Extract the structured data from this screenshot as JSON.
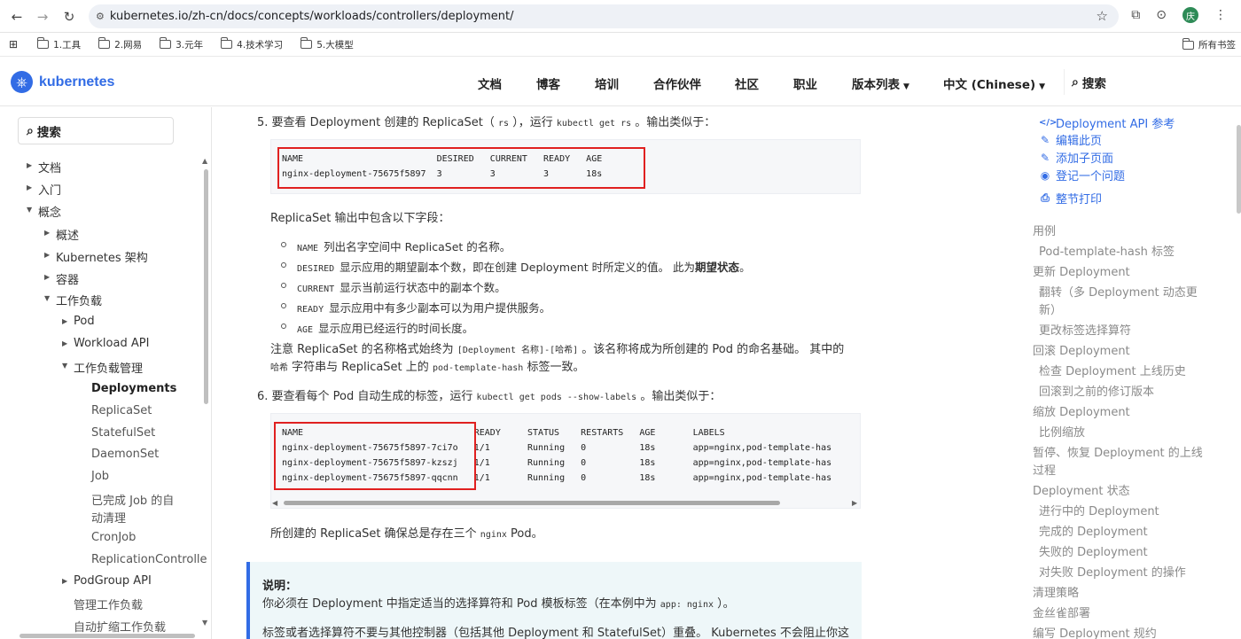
{
  "browser": {
    "url": "kubernetes.io/zh-cn/docs/concepts/workloads/controllers/deployment/",
    "avatar_text": "庆",
    "bookmarks": [
      "1.工具",
      "2.网易",
      "3.元年",
      "4.技术学习",
      "5.大模型"
    ],
    "all_bookmarks": "所有书签"
  },
  "header": {
    "logo": "kubernetes",
    "nav": [
      "文档",
      "博客",
      "培训",
      "合作伙伴",
      "社区",
      "职业",
      "版本列表",
      "中文 (Chinese)"
    ],
    "search": "搜索"
  },
  "sidebar": {
    "search": "搜索",
    "items": [
      {
        "label": "文档",
        "state": "collapsed"
      },
      {
        "label": "入门",
        "state": "collapsed"
      },
      {
        "label": "概念",
        "state": "expanded"
      },
      {
        "label": "概述",
        "state": "collapsed"
      },
      {
        "label": "Kubernetes 架构",
        "state": "collapsed"
      },
      {
        "label": "容器",
        "state": "collapsed"
      },
      {
        "label": "工作负载",
        "state": "expanded"
      },
      {
        "label": "Pod",
        "state": "collapsed"
      },
      {
        "label": "Workload API",
        "state": "collapsed"
      },
      {
        "label": "工作负载管理",
        "state": "expanded"
      },
      {
        "label": "Deployments",
        "state": "active"
      },
      {
        "label": "ReplicaSet",
        "state": "leaf"
      },
      {
        "label": "StatefulSet",
        "state": "leaf"
      },
      {
        "label": "DaemonSet",
        "state": "leaf"
      },
      {
        "label": "Job",
        "state": "leaf"
      },
      {
        "label": "已完成 Job 的自",
        "state": "leaf"
      },
      {
        "label": "动清理",
        "state": "leaf"
      },
      {
        "label": "CronJob",
        "state": "leaf"
      },
      {
        "label": "ReplicationControlle",
        "state": "leaf"
      },
      {
        "label": "PodGroup API",
        "state": "collapsed"
      },
      {
        "label": "管理工作负载",
        "state": "leaf"
      },
      {
        "label": "自动扩缩工作负载",
        "state": "leaf"
      }
    ]
  },
  "content": {
    "step5": {
      "num": "5.",
      "text_a": "要查看 Deployment 创建的 ReplicaSet（",
      "code_a": "rs",
      "text_b": "），运行",
      "code_b": "kubectl get rs",
      "text_c": "。输出类似于："
    },
    "rs_output": {
      "line1": "NAME                         DESIRED   CURRENT   READY   AGE",
      "line2": "nginx-deployment-75675f5897  3         3         3       18s"
    },
    "rs_fields_intro": "ReplicaSet 输出中包含以下字段：",
    "fields": [
      {
        "code": "NAME",
        "text": "列出名字空间中 ReplicaSet 的名称。"
      },
      {
        "code": "DESIRED",
        "text": "显示应用的期望副本个数，即在创建 Deployment 时所定义的值。 此为",
        "bold": "期望状态",
        "tail": "。"
      },
      {
        "code": "CURRENT",
        "text": "显示当前运行状态中的副本个数。"
      },
      {
        "code": "READY",
        "text": "显示应用中有多少副本可以为用户提供服务。"
      },
      {
        "code": "AGE",
        "text": "显示应用已经运行的时间长度。"
      }
    ],
    "note_line1_a": "注意 ReplicaSet 的名称格式始终为",
    "note_line1_code": "[Deployment 名称]-[哈希]",
    "note_line1_b": "。该名称将成为所创建的 Pod 的命名基础。 其中的",
    "note_line2_code_a": "哈希",
    "note_line2_a": "字符串与 ReplicaSet 上的",
    "note_line2_code_b": "pod-template-hash",
    "note_line2_b": "标签一致。",
    "step6": {
      "num": "6.",
      "text_a": "要查看每个 Pod 自动生成的标签，运行",
      "code_a": "kubectl get pods --show-labels",
      "text_b": "。输出类似于："
    },
    "pods_output": {
      "line1": "NAME                                READY     STATUS    RESTARTS   AGE       LABELS",
      "line2": "nginx-deployment-75675f5897-7ci7o   1/1       Running   0          18s       app=nginx,pod-template-has",
      "line3": "nginx-deployment-75675f5897-kzszj   1/1       Running   0          18s       app=nginx,pod-template-has",
      "line4": "nginx-deployment-75675f5897-qqcnn   1/1       Running   0          18s       app=nginx,pod-template-has"
    },
    "replicaset_note_a": "所创建的 ReplicaSet 确保总是存在三个",
    "replicaset_note_code": "nginx",
    "replicaset_note_b": "Pod。",
    "callout": {
      "title": "说明：",
      "line1_a": "你必须在 Deployment 中指定适当的选择算符和 Pod 模板标签（在本例中为",
      "line1_code": "app: nginx",
      "line1_b": "）。",
      "line2": "标签或者选择算符不要与其他控制器（包括其他 Deployment 和 StatefulSet）重叠。 Kubernetes 不会阻止你这"
    }
  },
  "toc": {
    "actions": [
      {
        "icon": "code-icon",
        "label": "Deployment API 参考"
      },
      {
        "icon": "edit-icon",
        "label": "编辑此页"
      },
      {
        "icon": "edit-icon",
        "label": "添加子页面"
      },
      {
        "icon": "github-icon",
        "label": "登记一个问题"
      },
      {
        "icon": "print-icon",
        "label": "整节打印"
      }
    ],
    "items": [
      {
        "label": "用例",
        "level": 1
      },
      {
        "label": "Pod-template-hash 标签",
        "level": 2
      },
      {
        "label": "更新 Deployment",
        "level": 1
      },
      {
        "label": "翻转（多 Deployment 动态更",
        "level": 2
      },
      {
        "label": "新）",
        "level": 2
      },
      {
        "label": "更改标签选择算符",
        "level": 2
      },
      {
        "label": "回滚 Deployment",
        "level": 1
      },
      {
        "label": "检查 Deployment 上线历史",
        "level": 2
      },
      {
        "label": "回滚到之前的修订版本",
        "level": 2
      },
      {
        "label": "缩放 Deployment",
        "level": 1
      },
      {
        "label": "比例缩放",
        "level": 2
      },
      {
        "label": "暂停、恢复 Deployment 的上线",
        "level": 1
      },
      {
        "label": "过程",
        "level": 1
      },
      {
        "label": "Deployment 状态",
        "level": 1
      },
      {
        "label": "进行中的 Deployment",
        "level": 2
      },
      {
        "label": "完成的 Deployment",
        "level": 2
      },
      {
        "label": "失败的 Deployment",
        "level": 2
      },
      {
        "label": "对失败 Deployment 的操作",
        "level": 2
      },
      {
        "label": "清理策略",
        "level": 1
      },
      {
        "label": "金丝雀部署",
        "level": 1
      },
      {
        "label": "编写 Deployment 规约",
        "level": 1
      }
    ]
  }
}
